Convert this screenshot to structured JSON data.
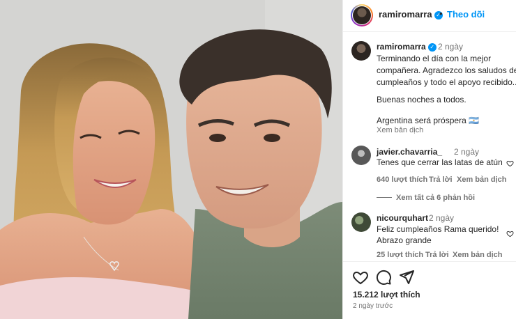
{
  "header": {
    "username": "ramiromarra",
    "separator": "•",
    "follow_label": "Theo dõi"
  },
  "caption": {
    "username": "ramiromarra",
    "time": "2 ngày",
    "lines": [
      "Terminando el día con la mejor",
      "compañera. Agradezco los saludos de",
      "cumpleaños y todo el apoyo recibido..",
      "",
      "Buenas noches a todos.",
      "",
      "Argentina será próspera 🇦🇷"
    ],
    "translate": "Xem bản dịch"
  },
  "comments": [
    {
      "username": "javier.chavarria_",
      "time": "2 ngày",
      "text": "Tenes que cerrar las latas de atún",
      "likes": "640 lượt thích",
      "reply": "Trả lời",
      "translate": "Xem bản dịch",
      "view_replies": "Xem tất cả 6 phản hồi"
    },
    {
      "username": "nicourquhart",
      "time": "2 ngày",
      "text_lines": [
        "Feliz cumpleaños Rama querido!",
        "Abrazo grande"
      ],
      "likes": "25 lượt thích",
      "reply": "Trả lời",
      "translate": "Xem bản dịch"
    }
  ],
  "footer": {
    "likes": "15.212 lượt thích",
    "time_ago": "2 ngày trước"
  },
  "icons": {
    "like": "heart-icon",
    "comment": "comment-icon",
    "share": "share-icon",
    "verified": "verified-badge-icon"
  },
  "colors": {
    "accent": "#0095f6",
    "text": "#262626",
    "muted": "#737373",
    "border": "#efefef"
  }
}
